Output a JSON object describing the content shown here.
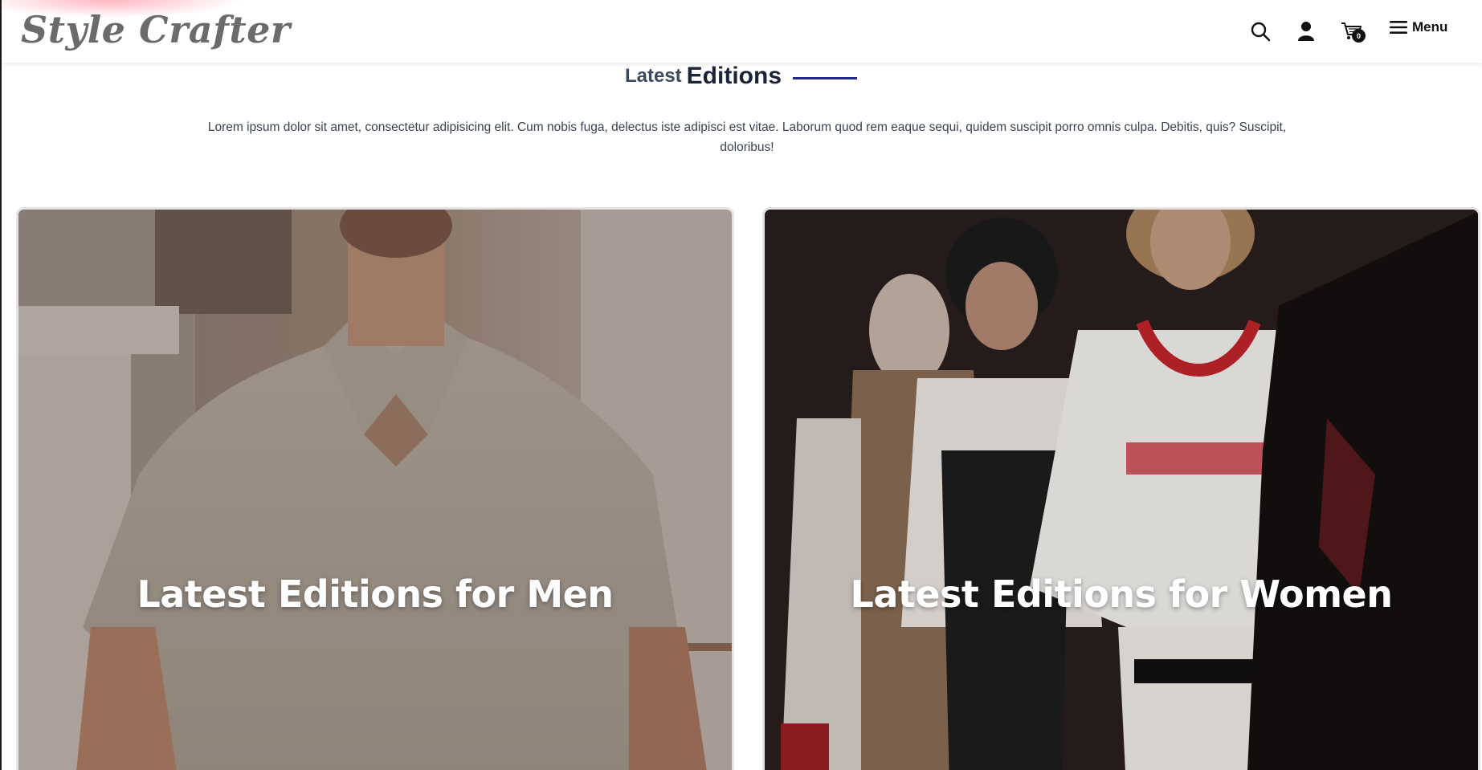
{
  "header": {
    "logo": "Style Crafter",
    "search_icon": "search-icon",
    "account_icon": "user-icon",
    "cart_icon": "cart-icon",
    "cart_count": "0",
    "menu_icon": "hamburger-icon",
    "menu_label": "Menu"
  },
  "section": {
    "title_light": "Latest",
    "title_bold": "Editions",
    "intro": "Lorem ipsum dolor sit amet, consectetur adipisicing elit. Cum nobis fuga, delectus iste adipisci est vitae. Laborum quod rem eaque sequi, quidem suscipit porro omnis culpa. Debitis, quis? Suscipit, doloribus!"
  },
  "cards": [
    {
      "caption": "Latest Editions for Men"
    },
    {
      "caption": "Latest Editions for Women"
    }
  ],
  "colors": {
    "accent_line": "#232a8a",
    "title": "#1c2538",
    "logo": "#6b6b6b"
  }
}
